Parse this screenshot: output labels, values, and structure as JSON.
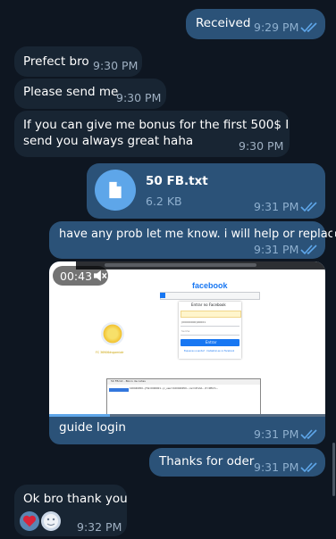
{
  "colors": {
    "background": "#0e1621",
    "incoming": "#182533",
    "outgoing": "#2b5278",
    "accent": "#5ea6e9"
  },
  "messages": {
    "m1": {
      "text": "Received",
      "time": "9:29 PM"
    },
    "m2": {
      "text": "Prefect bro",
      "time": "9:30 PM"
    },
    "m3": {
      "text": "Please send me",
      "time": "9:30 PM"
    },
    "m4": {
      "line1": "If you can give me bonus for the first 500$ I",
      "line2": "send you always great haha",
      "time": "9:30 PM"
    },
    "m5": {
      "file_name": "50 FB.txt",
      "file_size": "6.2 KB",
      "time": "9:31 PM",
      "icon": "file-icon"
    },
    "m6": {
      "text": "have any prob let me know. i will help or replace",
      "time": "9:31 PM"
    },
    "m7": {
      "video_duration": "00:43",
      "caption": "guide login",
      "time": "9:31 PM",
      "video": {
        "brand": "facebook",
        "login_title": "Entrar no Facebook",
        "phone_value": "(00000000)00001",
        "password_placeholder": "Senha",
        "login_button": "Entrar",
        "links": "Esqueceu a senha? · Cadastrar-se no Facebook",
        "notepad_title": "50 FB.txt - Bloco de notas",
        "notepad_line": "100040050...|Fzk:0000001...|c_user=100040050...;xs=16%3A...;fr=0ftkYv...",
        "badge_text": "FC 36906dvgamiotr"
      }
    },
    "m8": {
      "text": "Thanks for oder",
      "time": "9:31 PM"
    },
    "m9": {
      "text": "Ok bro thank you",
      "time": "9:32 PM"
    }
  }
}
